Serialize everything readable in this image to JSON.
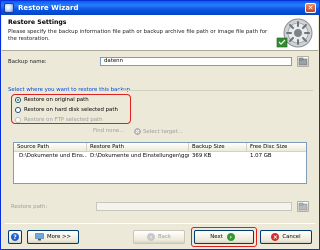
{
  "window": {
    "title": "Restore Wizard",
    "close_glyph": "✕"
  },
  "header": {
    "title": "Restore Settings",
    "description": "Please specify the backup information file path or backup archive file path or image file path for the restoration."
  },
  "backup_name": {
    "label": "Backup name:",
    "value": "datenn"
  },
  "restore_location": {
    "section_label": "Select where you want to restore this backup",
    "options": [
      {
        "label": "Restore on original path",
        "checked": true,
        "enabled": true
      },
      {
        "label": "Restore on hard disk selected path",
        "checked": false,
        "enabled": true
      },
      {
        "label": "Restore on FTP selected path",
        "checked": false,
        "enabled": false
      }
    ],
    "find_none_label": "Find none...",
    "select_target_label": "Select target..."
  },
  "table": {
    "columns": [
      "Source Path",
      "Restore Path",
      "Backup Size",
      "Free Disc Size"
    ],
    "rows": [
      {
        "source": "D:\\Dokumente und Eins...",
        "restore": "D:\\Dokumente und Einstellungen\\ggr...",
        "size": "369 KB",
        "free": "1.07 GB"
      }
    ]
  },
  "restore_path": {
    "label": "Restore path:",
    "value": ""
  },
  "buttons": {
    "help": "?",
    "more": "More >>",
    "back": "Back",
    "next": "Next",
    "cancel": "Cancel"
  },
  "colors": {
    "highlight": "#e01f1f",
    "accent": "#0046d5"
  }
}
